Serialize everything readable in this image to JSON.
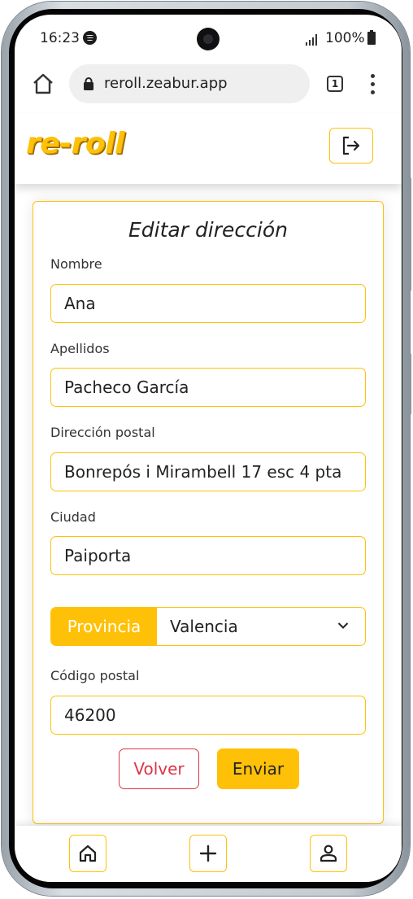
{
  "status_bar": {
    "time": "16:23",
    "battery": "100%",
    "icons": [
      "spotify-icon",
      "signal-icon",
      "battery-icon"
    ]
  },
  "browser": {
    "url": "reroll.zeabur.app",
    "tab_count": "1",
    "icons": [
      "home-icon",
      "lock-icon",
      "more-vert-icon"
    ]
  },
  "app": {
    "logo": "re-roll",
    "brand_color": "#ffc107",
    "icons": [
      "logout-icon"
    ]
  },
  "form": {
    "title": "Editar dirección",
    "fields": [
      {
        "label": "Nombre",
        "value": "Ana"
      },
      {
        "label": "Apellidos",
        "value": "Pacheco García"
      },
      {
        "label": "Dirección postal",
        "value": "Bonrepós i Mirambell 17 esc 4 pta"
      },
      {
        "label": "Ciudad",
        "value": "Paiporta"
      }
    ],
    "province": {
      "label": "Provincia",
      "selected": "Valencia"
    },
    "postal_code": {
      "label": "Código postal",
      "value": "46200"
    },
    "buttons": {
      "back": "Volver",
      "submit": "Enviar"
    },
    "danger_color": "#dc3545"
  },
  "bottom_nav": {
    "items": [
      "home-icon",
      "plus-icon",
      "user-icon"
    ]
  }
}
